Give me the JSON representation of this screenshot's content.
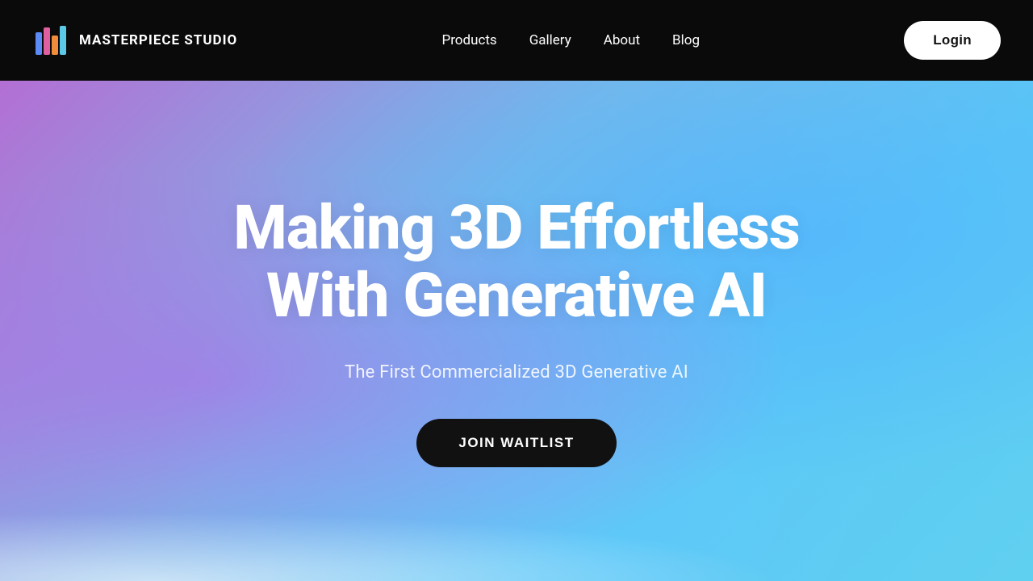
{
  "nav": {
    "logo_text_light": "MASTERPIECE ",
    "logo_text_bold": "STUDIO",
    "links": [
      {
        "label": "Products",
        "id": "products"
      },
      {
        "label": "Gallery",
        "id": "gallery"
      },
      {
        "label": "About",
        "id": "about"
      },
      {
        "label": "Blog",
        "id": "blog"
      }
    ],
    "login_label": "Login"
  },
  "hero": {
    "title_line1": "Making 3D Effortless",
    "title_line2": "With Generative AI",
    "subtitle": "The First Commercialized 3D Generative AI",
    "cta_label": "JOIN WAITLIST"
  }
}
